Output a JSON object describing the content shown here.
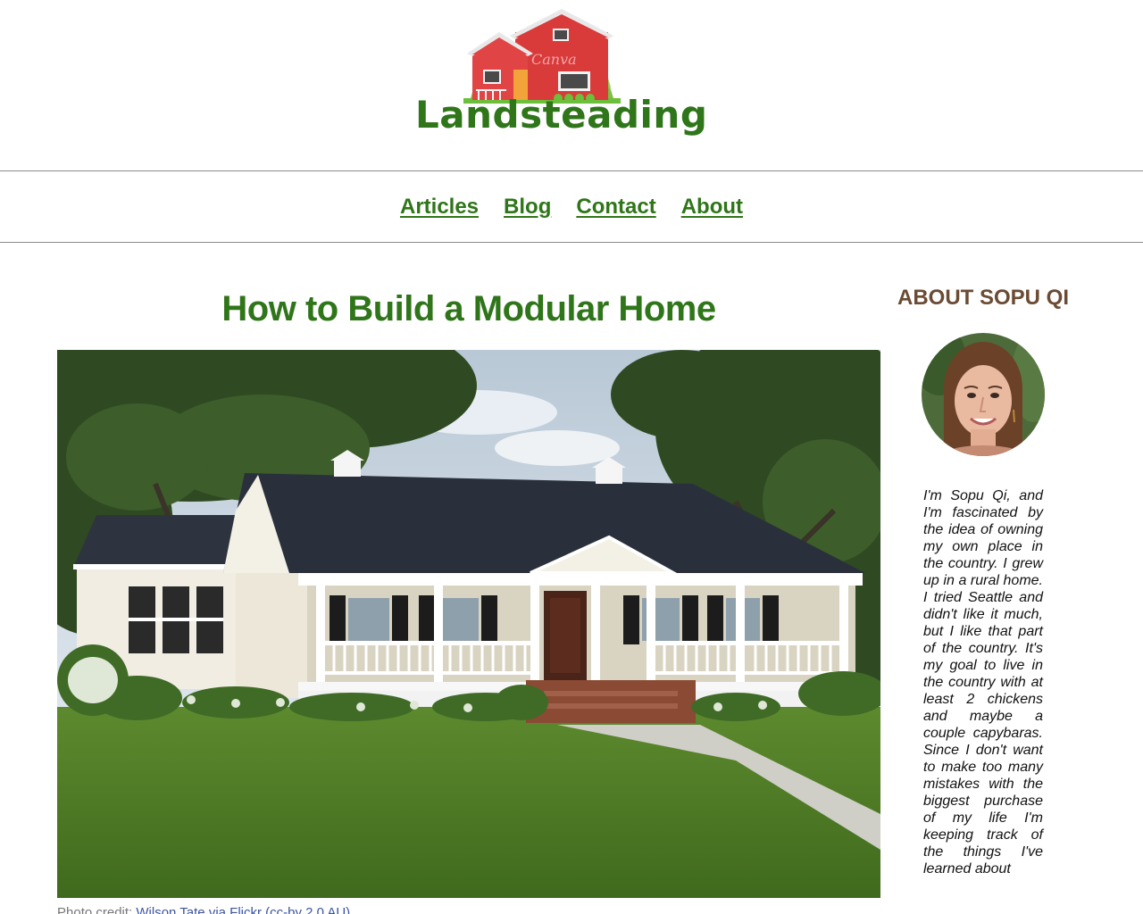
{
  "site": {
    "name": "Landsteading",
    "logo_watermark": "Canva"
  },
  "nav": {
    "items": [
      {
        "label": "Articles"
      },
      {
        "label": "Blog"
      },
      {
        "label": "Contact"
      },
      {
        "label": "About"
      }
    ]
  },
  "post": {
    "title": "How to Build a Modular Home",
    "image_alt": "Modular ranch-style home with covered front porch",
    "photo_credit_prefix": "Photo credit: ",
    "photo_credit_link": "Wilson Tate via Flickr (cc-by 2.0 AU)"
  },
  "sidebar": {
    "title": "ABOUT SOPU QI",
    "bio": "I'm Sopu Qi, and I'm fascinated by the idea of owning my own place in the country. I grew up in a rural home. I tried Seattle and didn't like it much, but I like that part of the country. It's my goal to live in the country with at least 2 chickens and maybe a couple capybaras. Since I don't want to make too many mistakes with the biggest purchase of my life I'm keeping track of the things I've learned about"
  },
  "colors": {
    "brand_green": "#2f7519",
    "sidebar_brown": "#6a4b34",
    "divider": "#8a8a8a"
  }
}
